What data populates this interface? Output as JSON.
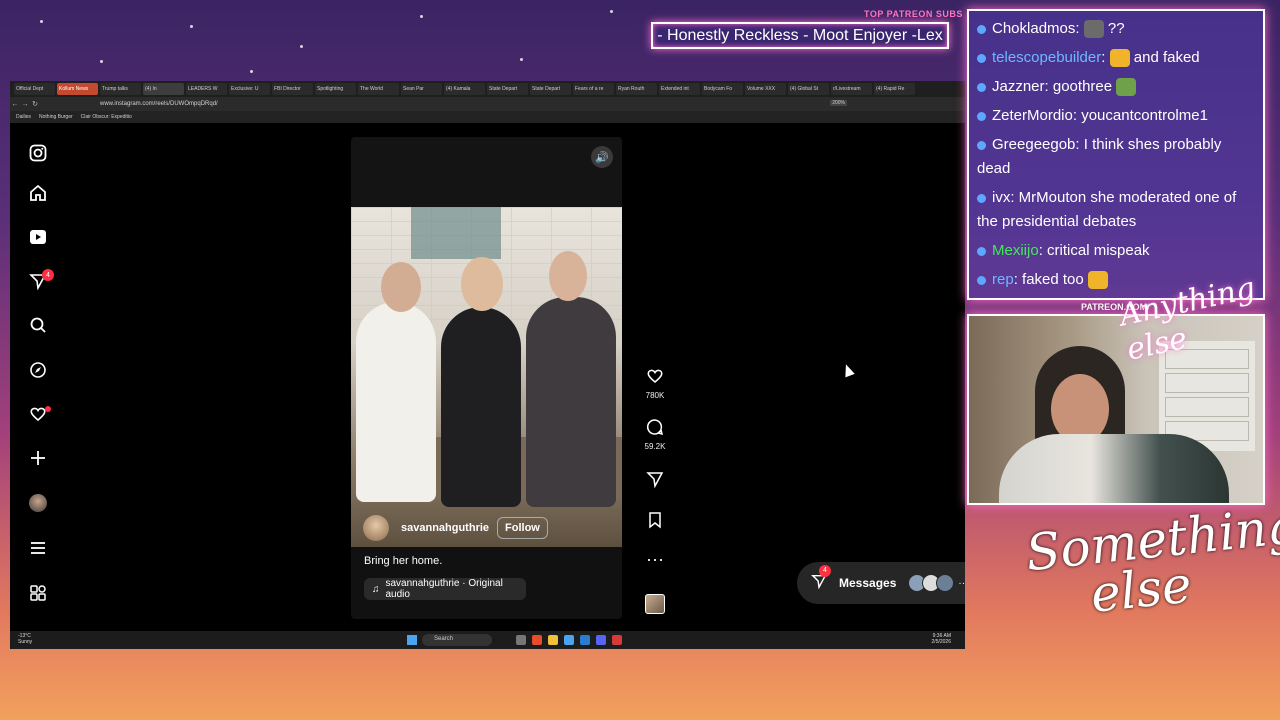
{
  "overlay": {
    "patreon_top_label": "TOP PATREON SUBS",
    "patreon_top_names": "- Honestly Reckless - Moot Enjoyer -Lex",
    "patreon_url": "PATREON.COM/",
    "logo_text": "Anything else",
    "big_logo_line1": "Something",
    "big_logo_line2": "else"
  },
  "browser": {
    "tabs": [
      "Official Dept",
      "Kollum News",
      "Trump talks",
      "(4) In",
      "LEADERS W",
      "Exclusive: U",
      "FBI Director",
      "Spotlighting",
      "The World",
      "Sean Par",
      "(4) Kamala",
      "State Depart",
      "State Depart",
      "Fears of a re",
      "Ryan Routh",
      "Extended int",
      "Bodycam Fo",
      "Volume XXX",
      "(4) Global St",
      "r/Livestream",
      "(4) Rapid Re"
    ],
    "url": "www.instagram.com/reels/DUWOmpqDRqd/",
    "zoom": "200%",
    "bookmarks": [
      "Dailies",
      "Nothing Burger",
      "Clair Obscur: Expeditio"
    ]
  },
  "instagram": {
    "notif_badge": "4",
    "reel": {
      "author": "savannahguthrie",
      "follow_label": "Follow",
      "caption": "Bring her home.",
      "audio": "savannahguthrie · Original audio"
    },
    "actions": {
      "likes": "780K",
      "comments": "59.2K"
    },
    "messages": {
      "label": "Messages",
      "badge": "4"
    }
  },
  "taskbar": {
    "weather_temp": "-13°C",
    "weather_cond": "Sunny",
    "search_label": "Search",
    "time": "9:36 AM",
    "date": "2/5/2026"
  },
  "chat": [
    {
      "user": "Chokladmos",
      "color": "white",
      "text": " ??",
      "emote": "gray"
    },
    {
      "user": "telescopebuilder",
      "color": "blue",
      "text": " and faked",
      "emote": "yellow"
    },
    {
      "user": "Jazzner",
      "color": "white",
      "text": " goothree",
      "emote": "green"
    },
    {
      "user": "ZeterMordio",
      "color": "white",
      "text": " youcantcontrolme1",
      "emote": ""
    },
    {
      "user": "Greegeegob",
      "color": "white",
      "text": " I think shes probably dead",
      "emote": ""
    },
    {
      "user": "ivx",
      "color": "white",
      "text": " MrMouton she moderated one of the presidential debates",
      "emote": ""
    },
    {
      "user": "Mexiijo",
      "color": "green",
      "text": " critical mispeak",
      "emote": ""
    },
    {
      "user": "rep",
      "color": "blue",
      "text": " faked too",
      "emote": "yellow"
    }
  ]
}
